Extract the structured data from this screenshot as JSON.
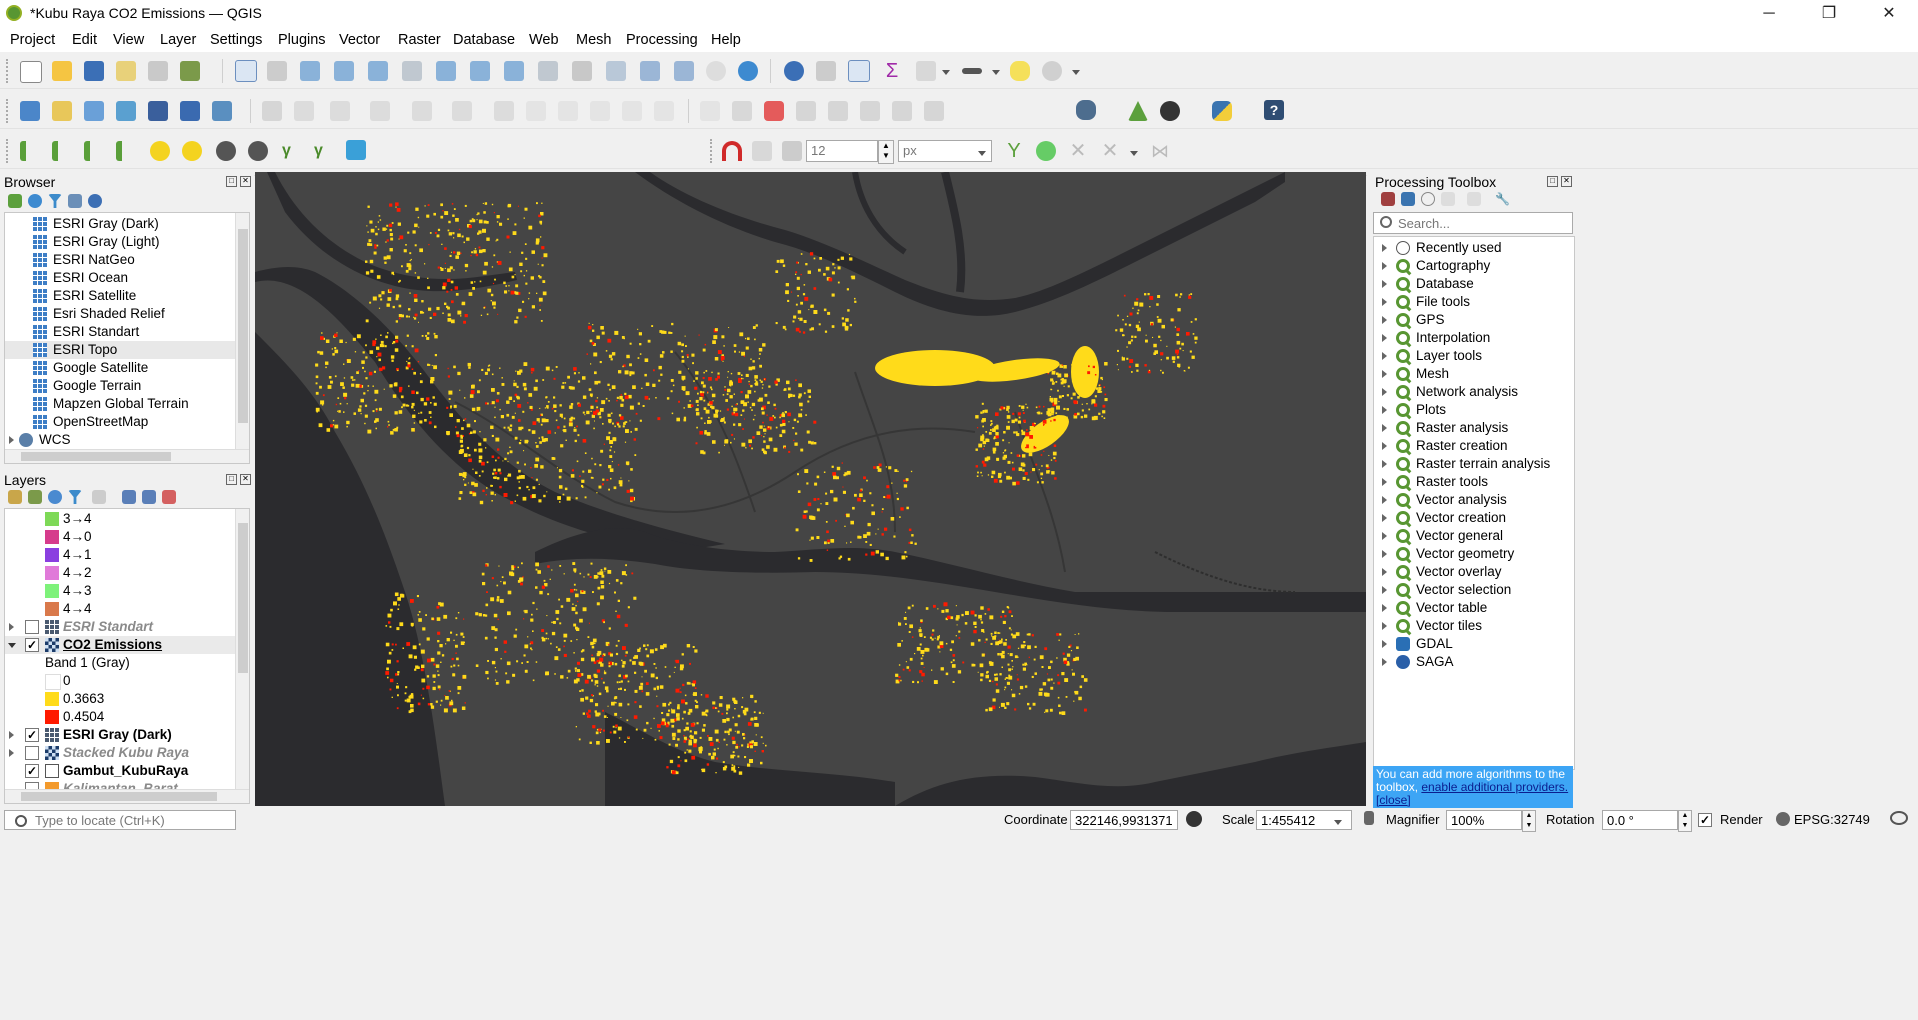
{
  "window": {
    "title": "*Kubu Raya CO2 Emissions — QGIS",
    "minimize": "─",
    "maximize": "❐",
    "close": "✕"
  },
  "menu": [
    "Project",
    "Edit",
    "View",
    "Layer",
    "Settings",
    "Plugins",
    "Vector",
    "Raster",
    "Database",
    "Web",
    "Mesh",
    "Processing",
    "Help"
  ],
  "toolbar": {
    "font_size_value": "12",
    "font_unit_value": "px"
  },
  "browser": {
    "title": "Browser",
    "items": [
      "ESRI Gray (Dark)",
      "ESRI Gray (Light)",
      "ESRI NatGeo",
      "ESRI Ocean",
      "ESRI Satellite",
      "Esri Shaded Relief",
      "ESRI Standart",
      "ESRI Topo",
      "Google Satellite",
      "Google Terrain",
      "Mapzen Global Terrain",
      "OpenStreetMap",
      "WCS"
    ],
    "selected": "ESRI Topo"
  },
  "layers": {
    "title": "Layers",
    "legend_classes": [
      {
        "label": "3→4",
        "color": "#7ed957"
      },
      {
        "label": "4→0",
        "color": "#d63b8c"
      },
      {
        "label": "4→1",
        "color": "#8a3fe0"
      },
      {
        "label": "4→2",
        "color": "#e07ad9"
      },
      {
        "label": "4→3",
        "color": "#7ef27a"
      },
      {
        "label": "4→4",
        "color": "#d9794b"
      }
    ],
    "esri_standart": "ESRI Standart",
    "co2": "CO2 Emissions",
    "band": "Band 1 (Gray)",
    "co2_values": [
      {
        "label": "0",
        "color": "#ffffff"
      },
      {
        "label": "0.3663",
        "color": "#ffdb1a"
      },
      {
        "label": "0.4504",
        "color": "#ff1a00"
      }
    ],
    "esri_gray_dark": "ESRI Gray (Dark)",
    "stacked": "Stacked Kubu Raya",
    "gambut": "Gambut_KubuRaya",
    "kalimantan": "Kalimantan_Barat",
    "kalimantan_color": "#f39a2c"
  },
  "toolbox": {
    "title": "Processing Toolbox",
    "search_placeholder": "Search...",
    "items": [
      "Recently used",
      "Cartography",
      "Database",
      "File tools",
      "GPS",
      "Interpolation",
      "Layer tools",
      "Mesh",
      "Network analysis",
      "Plots",
      "Raster analysis",
      "Raster creation",
      "Raster terrain analysis",
      "Raster tools",
      "Vector analysis",
      "Vector creation",
      "Vector general",
      "Vector geometry",
      "Vector overlay",
      "Vector selection",
      "Vector table",
      "Vector tiles",
      "GDAL",
      "SAGA"
    ],
    "notice_text": "You can add more algorithms to the toolbox,",
    "notice_link": "enable additional providers.",
    "notice_close": "[close]"
  },
  "status": {
    "locate_placeholder": "Type to locate (Ctrl+K)",
    "coordinate_label": "Coordinate",
    "coordinate_value": "322146,9931371",
    "scale_label": "Scale",
    "scale_value": "1:455412",
    "magnifier_label": "Magnifier",
    "magnifier_value": "100%",
    "rotation_label": "Rotation",
    "rotation_value": "0.0 °",
    "render_label": "Render",
    "crs": "EPSG:32749"
  },
  "colors": {
    "map_bg": "#454545",
    "water": "#2b2b2e",
    "yellow": "#ffdb1a",
    "red": "#ff1a00",
    "notice_bg": "#3da5f5"
  }
}
